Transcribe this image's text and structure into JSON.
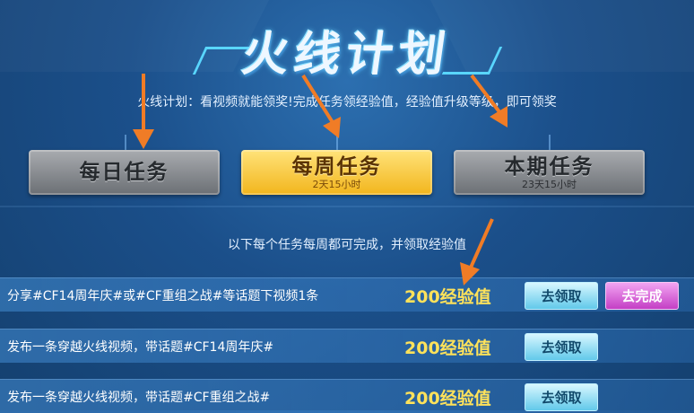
{
  "header": {
    "title": "火线计划",
    "subtitle": "火线计划：看视频就能领奖!完成任务领经验值，经验值升级等级，即可领奖"
  },
  "tabs": [
    {
      "label": "每日任务",
      "time": "",
      "active": false
    },
    {
      "label": "每周任务",
      "time": "2天15小时",
      "active": true
    },
    {
      "label": "本期任务",
      "time": "23天15小时",
      "active": false
    }
  ],
  "info_text": "以下每个任务每周都可完成，并领取经验值",
  "tasks": [
    {
      "text": "分享#CF14周年庆#或#CF重组之战#等话题下视频1条",
      "reward": "200经验值",
      "claim": "去领取",
      "complete": "去完成"
    },
    {
      "text": "发布一条穿越火线视频，带话题#CF14周年庆#",
      "reward": "200经验值",
      "claim": "去领取"
    },
    {
      "text": "发布一条穿越火线视频，带话题#CF重组之战#",
      "reward": "200经验值",
      "claim": "去领取"
    }
  ],
  "colors": {
    "accent_gold": "#f2b51c",
    "reward_text": "#ffe25a",
    "arrow": "#f07c26",
    "complete_btn": "#c43fc5"
  }
}
